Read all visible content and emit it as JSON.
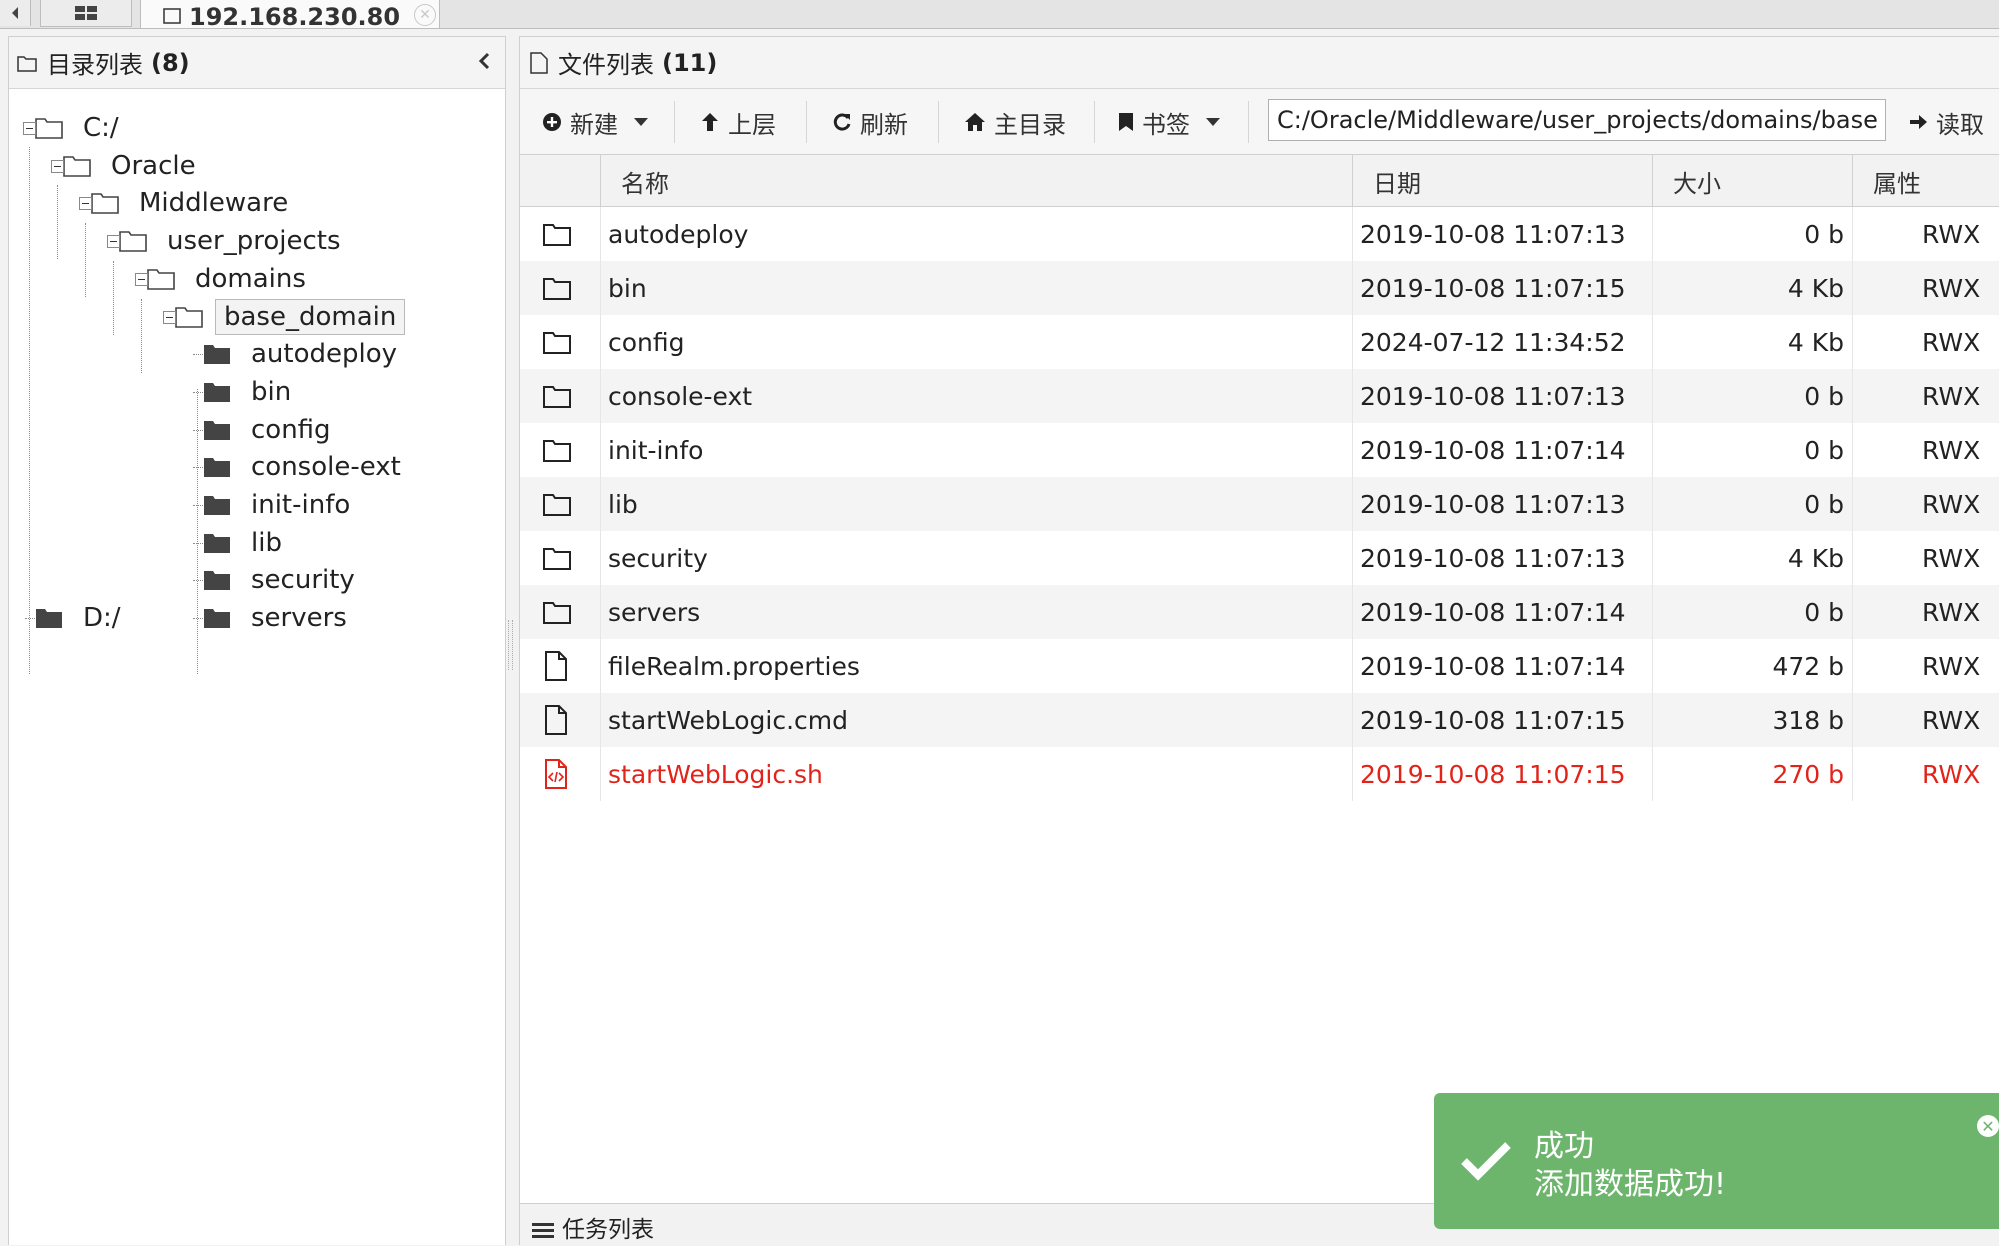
{
  "tabs": {
    "host_label": "192.168.230.80"
  },
  "dir_panel": {
    "title": "目录列表",
    "count": "(8)",
    "tree": [
      {
        "label": "C:/"
      },
      {
        "label": "Oracle"
      },
      {
        "label": "Middleware"
      },
      {
        "label": "user_projects"
      },
      {
        "label": "domains"
      },
      {
        "label": "base_domain"
      },
      {
        "label": "autodeploy"
      },
      {
        "label": "bin"
      },
      {
        "label": "config"
      },
      {
        "label": "console-ext"
      },
      {
        "label": "init-info"
      },
      {
        "label": "lib"
      },
      {
        "label": "security"
      },
      {
        "label": "servers"
      },
      {
        "label": "D:/"
      }
    ]
  },
  "file_panel": {
    "title": "文件列表",
    "count": "(11)",
    "toolbar": {
      "new_label": "新建",
      "up_label": "上层",
      "refresh_label": "刷新",
      "home_label": "主目录",
      "bookmark_label": "书签",
      "path_value": "C:/Oracle/Middleware/user_projects/domains/base_domain/",
      "read_label": "读取"
    },
    "columns": [
      "名称",
      "日期",
      "大小",
      "属性"
    ],
    "rows": [
      {
        "icon": "folder-icon",
        "name": "autodeploy",
        "date": "2019-10-08 11:07:13",
        "size": "0 b",
        "attr": "RWX"
      },
      {
        "icon": "folder-icon",
        "name": "bin",
        "date": "2019-10-08 11:07:15",
        "size": "4 Kb",
        "attr": "RWX"
      },
      {
        "icon": "folder-icon",
        "name": "config",
        "date": "2024-07-12 11:34:52",
        "size": "4 Kb",
        "attr": "RWX"
      },
      {
        "icon": "folder-icon",
        "name": "console-ext",
        "date": "2019-10-08 11:07:13",
        "size": "0 b",
        "attr": "RWX"
      },
      {
        "icon": "folder-icon",
        "name": "init-info",
        "date": "2019-10-08 11:07:14",
        "size": "0 b",
        "attr": "RWX"
      },
      {
        "icon": "folder-icon",
        "name": "lib",
        "date": "2019-10-08 11:07:13",
        "size": "0 b",
        "attr": "RWX"
      },
      {
        "icon": "folder-icon",
        "name": "security",
        "date": "2019-10-08 11:07:13",
        "size": "4 Kb",
        "attr": "RWX"
      },
      {
        "icon": "folder-icon",
        "name": "servers",
        "date": "2019-10-08 11:07:14",
        "size": "0 b",
        "attr": "RWX"
      },
      {
        "icon": "file-icon",
        "name": "fileRealm.properties",
        "date": "2019-10-08 11:07:14",
        "size": "472 b",
        "attr": "RWX"
      },
      {
        "icon": "file-icon",
        "name": "startWebLogic.cmd",
        "date": "2019-10-08 11:07:15",
        "size": "318 b",
        "attr": "RWX"
      },
      {
        "icon": "code-file-icon",
        "name": "startWebLogic.sh",
        "date": "2019-10-08 11:07:15",
        "size": "270 b",
        "attr": "RWX",
        "highlight": true
      }
    ]
  },
  "task_panel": {
    "title": "任务列表"
  },
  "toast": {
    "title": "成功",
    "message": "添加数据成功!"
  },
  "colors": {
    "highlight_text": "#e2231a",
    "toast_bg": "#6db56d"
  }
}
